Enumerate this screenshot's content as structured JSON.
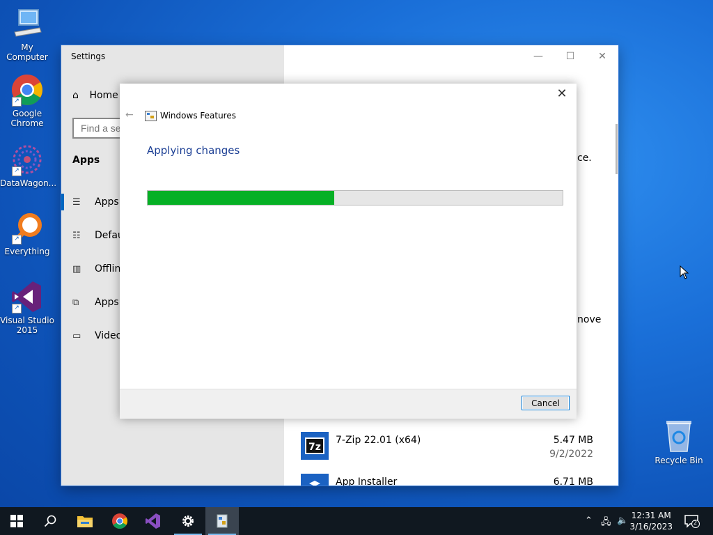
{
  "desktop": {
    "icons": [
      {
        "label": "My Computer"
      },
      {
        "label": "Google Chrome"
      },
      {
        "label": "DataWagon..."
      },
      {
        "label": "Everything"
      },
      {
        "label": "Visual Studio 2015"
      }
    ],
    "recycle_bin": "Recycle Bin"
  },
  "settings": {
    "title": "Settings",
    "home": "Home",
    "search_placeholder": "Find a se",
    "section": "Apps",
    "nav": [
      {
        "label": "Apps",
        "icon": "list-icon"
      },
      {
        "label": "Defau",
        "icon": "default-apps-icon"
      },
      {
        "label": "Offline",
        "icon": "map-icon"
      },
      {
        "label": "Apps",
        "icon": "open-in-icon"
      },
      {
        "label": "Video",
        "icon": "video-icon"
      }
    ],
    "partial_text_1": "ce.",
    "partial_text_2": "nove",
    "apps": [
      {
        "name": "7-Zip 22.01 (x64)",
        "size": "5.47 MB",
        "date": "9/2/2022"
      },
      {
        "name": "App Installer",
        "size": "6.71 MB"
      }
    ]
  },
  "dialog": {
    "title": "Windows Features",
    "heading": "Applying changes",
    "progress_fraction": 0.45,
    "cancel": "Cancel"
  },
  "taskbar": {
    "time": "12:31 AM",
    "date": "3/16/2023",
    "notification_count": "2"
  },
  "colors": {
    "progress_fill": "#06b025",
    "accent": "#0078d7"
  }
}
